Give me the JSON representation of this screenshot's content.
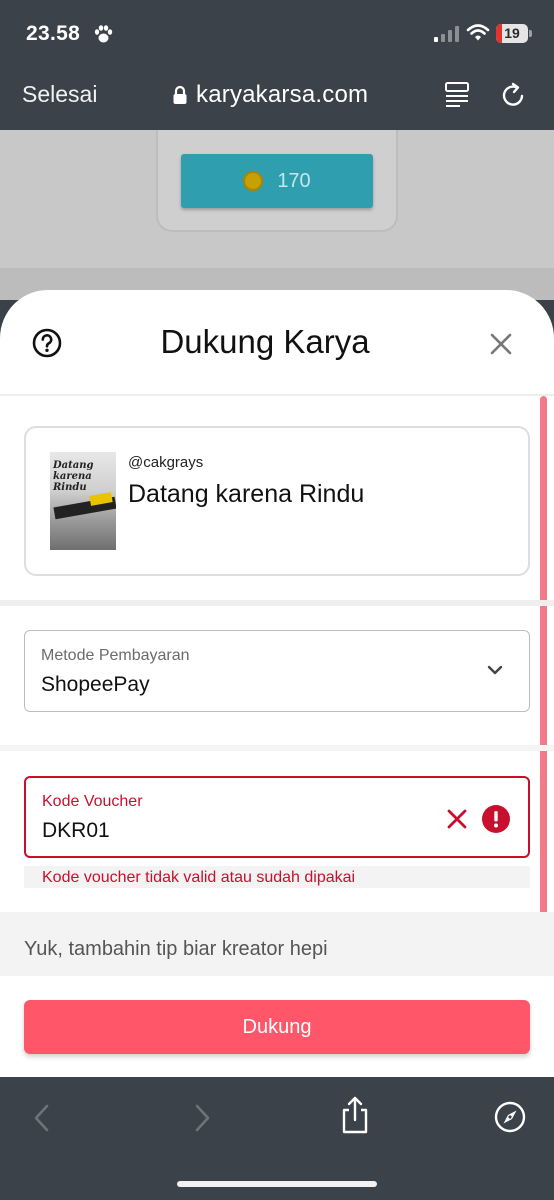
{
  "status_bar": {
    "time": "23.58",
    "battery": "19",
    "battery_level": 0.19
  },
  "browser": {
    "done_label": "Selesai",
    "url": "karyakarsa.com"
  },
  "background_page": {
    "coin_amount": "170"
  },
  "sheet": {
    "title": "Dukung Karya",
    "work": {
      "author": "@cakgrays",
      "title": "Datang karena Rindu",
      "cover_text": "Datang karena Rindu"
    },
    "payment": {
      "label": "Metode Pembayaran",
      "value": "ShopeePay"
    },
    "voucher": {
      "label": "Kode Voucher",
      "value": "DKR01",
      "error": "Kode voucher tidak valid atau sudah dipakai"
    },
    "tip_prompt": "Yuk, tambahin tip biar kreator hepi",
    "submit_label": "Dukung"
  },
  "colors": {
    "accent": "#ff5669",
    "error": "#c8102e",
    "chrome": "#3b4249"
  }
}
